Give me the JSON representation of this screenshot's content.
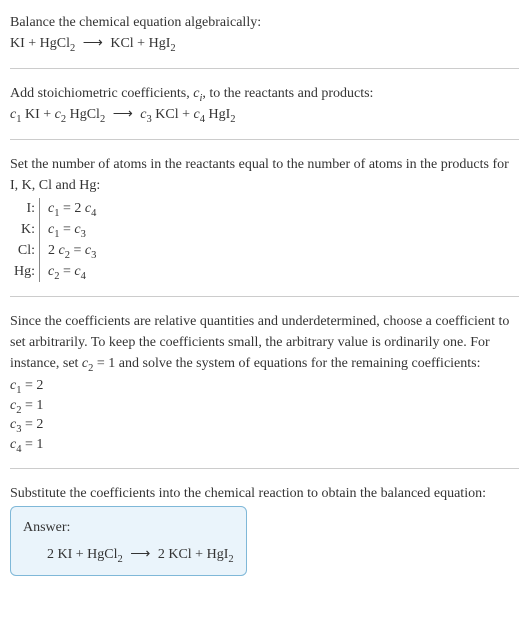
{
  "step1": {
    "intro": "Balance the chemical equation algebraically:",
    "eq_prefix": "KI + HgCl",
    "eq_sub1": "2",
    "eq_arrow": "⟶",
    "eq_mid": "KCl + HgI",
    "eq_sub2": "2"
  },
  "step2": {
    "intro_a": "Add stoichiometric coefficients, ",
    "intro_ci": "c",
    "intro_ci_sub": "i",
    "intro_b": ", to the reactants and products:",
    "c1": "c",
    "c1_sub": "1",
    "sp1": " KI + ",
    "c2": "c",
    "c2_sub": "2",
    "sp2": " HgCl",
    "sp2_sub": "2",
    "sp2_arrow": "⟶",
    "c3": "c",
    "c3_sub": "3",
    "sp3": " KCl + ",
    "c4": "c",
    "c4_sub": "4",
    "sp4": " HgI",
    "sp4_sub": "2"
  },
  "step3": {
    "intro": "Set the number of atoms in the reactants equal to the number of atoms in the products for I, K, Cl and Hg:",
    "rows": [
      {
        "elem": "I:",
        "c_l": "c",
        "l_sub": "1",
        "eq": " = 2 ",
        "c_r": "c",
        "r_sub": "4",
        "pre": ""
      },
      {
        "elem": "K:",
        "c_l": "c",
        "l_sub": "1",
        "eq": " = ",
        "c_r": "c",
        "r_sub": "3",
        "pre": ""
      },
      {
        "elem": "Cl:",
        "c_l": "c",
        "l_sub": "2",
        "eq": " = ",
        "c_r": "c",
        "r_sub": "3",
        "pre": "2 "
      },
      {
        "elem": "Hg:",
        "c_l": "c",
        "l_sub": "2",
        "eq": " = ",
        "c_r": "c",
        "r_sub": "4",
        "pre": ""
      }
    ]
  },
  "step4": {
    "intro_a": "Since the coefficients are relative quantities and underdetermined, choose a coefficient to set arbitrarily. To keep the coefficients small, the arbitrary value is ordinarily one. For instance, set ",
    "set_c": "c",
    "set_sub": "2",
    "set_val": " = 1",
    "intro_b": " and solve the system of equations for the remaining coefficients:",
    "solutions": [
      {
        "c": "c",
        "sub": "1",
        "val": " = 2"
      },
      {
        "c": "c",
        "sub": "2",
        "val": " = 1"
      },
      {
        "c": "c",
        "sub": "3",
        "val": " = 2"
      },
      {
        "c": "c",
        "sub": "4",
        "val": " = 1"
      }
    ]
  },
  "step5": {
    "intro": "Substitute the coefficients into the chemical reaction to obtain the balanced equation:",
    "answer_label": "Answer:",
    "eq_a": "2 KI + HgCl",
    "eq_sub1": "2",
    "eq_arrow": "⟶",
    "eq_b": "2 KCl + HgI",
    "eq_sub2": "2"
  }
}
